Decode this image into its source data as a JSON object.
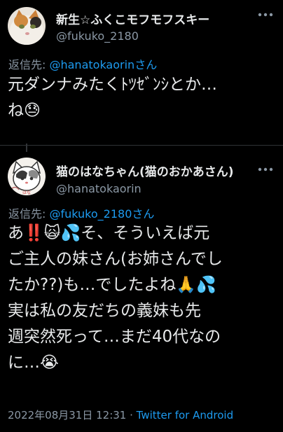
{
  "tweet1": {
    "display_name": "新生☆ふくこモフモフスキー",
    "handle": "@fukuko_2180",
    "reply_prefix": "返信先: ",
    "reply_mention": "@hanatokaorin",
    "reply_suffix": "さん",
    "body_lines": [
      "元ダンナみたくﾄﾂｾﾞﾝｼとか…",
      "ね😓"
    ],
    "more_icon": "more-dots-icon"
  },
  "tweet2": {
    "display_name": "猫のはなちゃん(猫のおかあさん)",
    "handle": "@hanatokaorin",
    "reply_prefix": "返信先: ",
    "reply_mention": "@fukuko_2180",
    "reply_suffix": "さん",
    "body_lines": [
      "あ‼️🙀💦そ、そういえば元",
      "ご主人の妹さん(お姉さんでし",
      "たか??)も…でしたよね🙏💦",
      "実は私の友だちの義妹も先",
      "週突然死って…まだ40代なの",
      "に…😭"
    ],
    "timestamp": "2022年08月31日 12:31",
    "separator": " · ",
    "source": "Twitter for Android",
    "more_icon": "more-dots-icon"
  },
  "colors": {
    "background": "#000000",
    "text": "#e7e9ea",
    "secondary": "#8b98a5",
    "link": "#1d9bf0"
  }
}
